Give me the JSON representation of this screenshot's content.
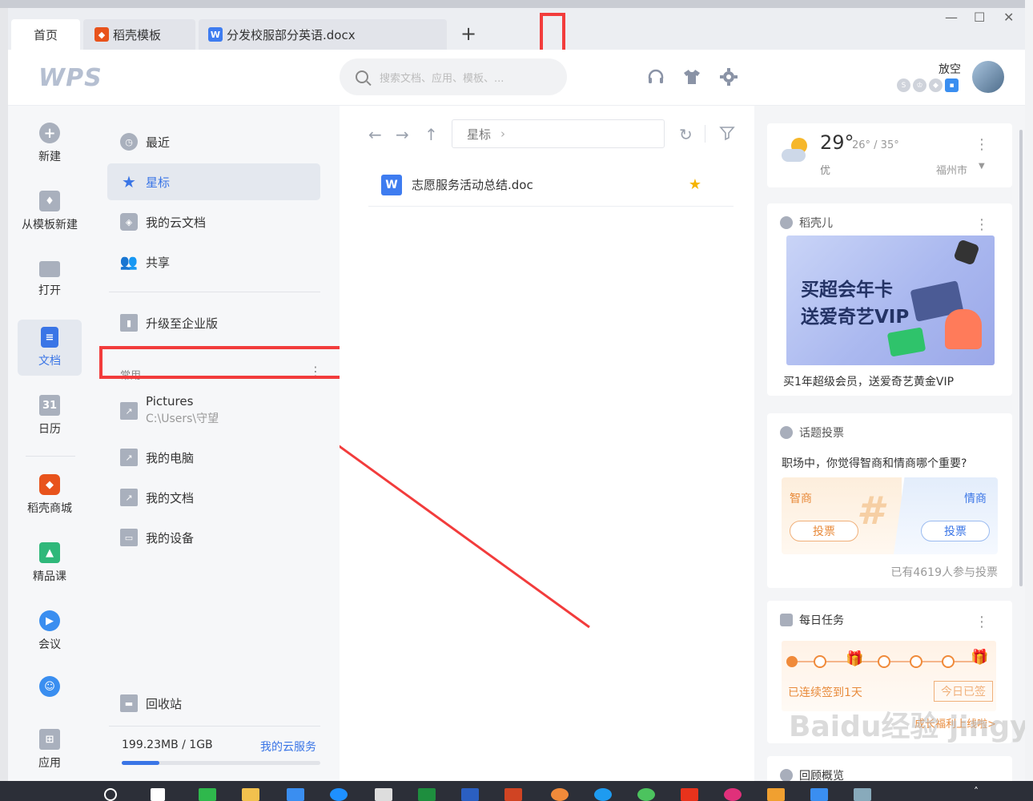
{
  "tabs": [
    {
      "label": "首页",
      "icon": "home-icon",
      "active": true
    },
    {
      "label": "稻壳模板",
      "icon": "docer-logo-icon",
      "color": "#e8531c"
    },
    {
      "label": "分发校服部分英语.docx",
      "icon": "word-doc-icon",
      "color": "#3e7cf0"
    }
  ],
  "header": {
    "logo": "WPS",
    "search_placeholder": "搜索文档、应用、模板、...",
    "username": "放空"
  },
  "leftnav": [
    {
      "label": "新建",
      "icon": "plus-circle-icon"
    },
    {
      "label": "从模板新建",
      "icon": "template-icon"
    },
    {
      "label": "打开",
      "icon": "folder-icon"
    },
    {
      "label": "文档",
      "icon": "document-icon",
      "active": true
    },
    {
      "label": "日历",
      "icon": "calendar-icon",
      "day": "31"
    },
    {
      "label": "稻壳商城",
      "icon": "docer-store-icon"
    },
    {
      "label": "精品课",
      "icon": "course-icon"
    },
    {
      "label": "会议",
      "icon": "meeting-icon"
    },
    {
      "label": "",
      "icon": "assistant-icon"
    },
    {
      "label": "应用",
      "icon": "apps-icon"
    }
  ],
  "sidebar": {
    "items": [
      {
        "label": "最近",
        "icon": "clock-icon"
      },
      {
        "label": "星标",
        "icon": "star-icon",
        "active": true
      },
      {
        "label": "我的云文档",
        "icon": "cloud-box-icon"
      },
      {
        "label": "共享",
        "icon": "people-icon"
      }
    ],
    "upgrade": "升级至企业版",
    "section_label": "常用",
    "common": [
      {
        "label": "Pictures",
        "sub": "C:\\Users\\守望",
        "icon": "folder-shortcut-icon"
      },
      {
        "label": "我的电脑",
        "icon": "computer-shortcut-icon"
      },
      {
        "label": "我的文档",
        "icon": "folder-shortcut-icon"
      },
      {
        "label": "我的设备",
        "icon": "device-icon"
      }
    ],
    "trash": "回收站",
    "storage": "199.23MB / 1GB",
    "storage_link": "我的云服务",
    "storage_used_fraction": 0.19
  },
  "main": {
    "breadcrumb": "星标",
    "files": [
      {
        "name": "志愿服务活动总结.doc",
        "starred": true
      }
    ]
  },
  "weather": {
    "temp": "29°",
    "range": "26° / 35°",
    "quality": "优",
    "city": "福州市"
  },
  "docer": {
    "title": "稻壳儿",
    "banner_line1": "买超会年卡",
    "banner_line2": "送爱奇艺VIP",
    "caption": "买1年超级会员，送爱奇艺黄金VIP"
  },
  "vote": {
    "title": "话题投票",
    "question": "职场中，你觉得智商和情商哪个重要?",
    "left": "智商",
    "right": "情商",
    "button": "投票",
    "count": "已有4619人参与投票"
  },
  "task": {
    "title": "每日任务",
    "streak": "已连续签到1天",
    "status": "今日已签",
    "link": "成长福利上线啦>"
  },
  "next_card_title": "回顾概览",
  "watermark": "Baidu经验 jingyan.baidu.com"
}
